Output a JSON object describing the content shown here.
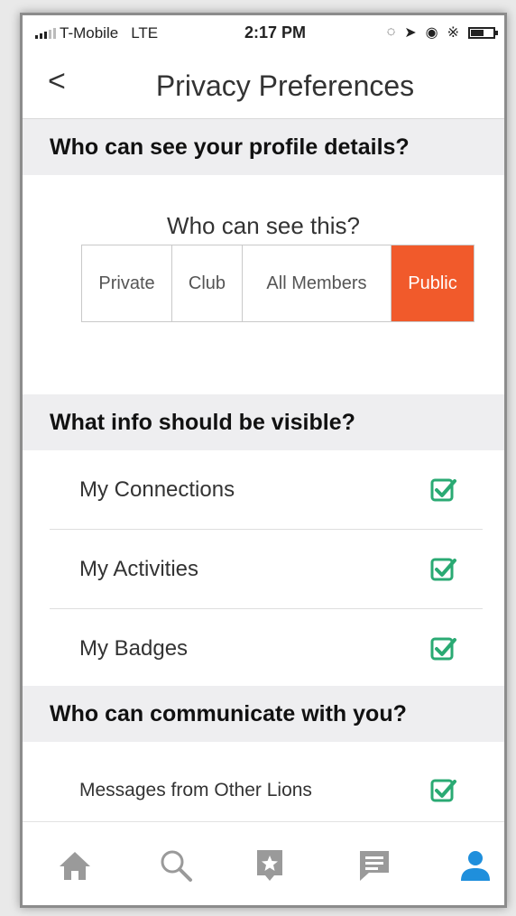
{
  "status": {
    "carrier": "T-Mobile",
    "network": "LTE",
    "time": "2:17 PM"
  },
  "nav": {
    "back_label": "<",
    "title": "Privacy Preferences"
  },
  "sections": {
    "profile_header": "Who can see your profile details?",
    "who_label": "Who can see this?",
    "visibility_options": [
      "Private",
      "Club",
      "All Members",
      "Public"
    ],
    "selected_visibility": "Public",
    "info_header": "What info should be visible?",
    "info_items": [
      "My Connections",
      "My Activities",
      "My Badges"
    ],
    "comm_header": "Who can communicate with you?",
    "comm_items": [
      "Messages from Other Lions"
    ]
  },
  "tabs": [
    "home-icon",
    "search-icon",
    "star-badge-icon",
    "message-icon",
    "profile-icon"
  ],
  "colors": {
    "accent": "#f15a2b",
    "check": "#2aaa73",
    "active_tab": "#1f8fdc",
    "inactive_tab": "#9a9a9a"
  }
}
